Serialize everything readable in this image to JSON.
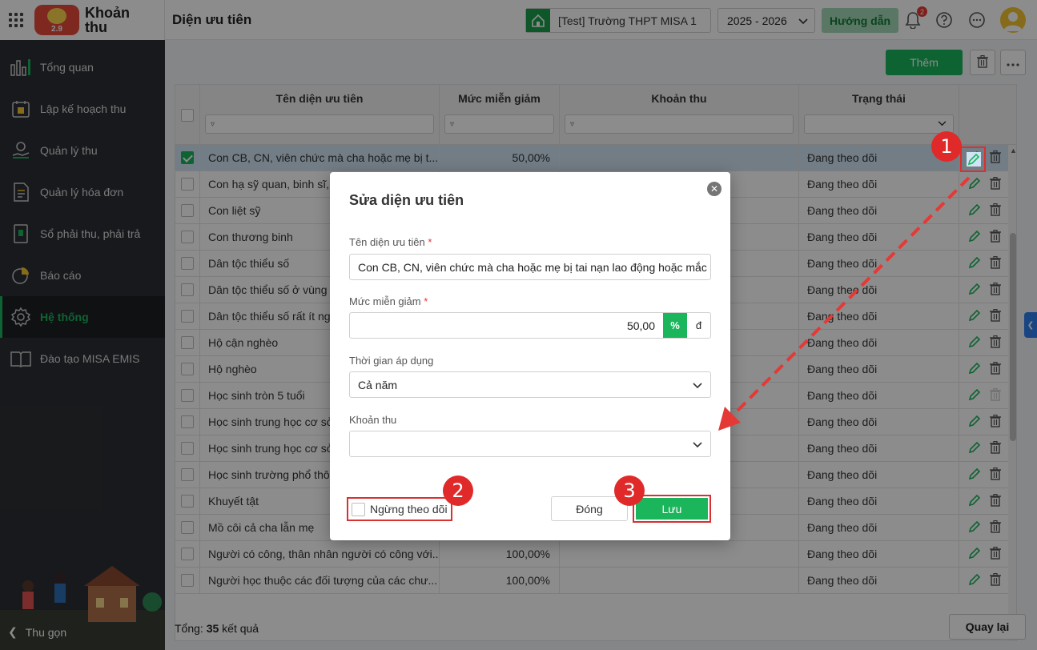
{
  "app": {
    "name": "Khoản thu",
    "logo_text": "2.9"
  },
  "sidebar": {
    "items": [
      {
        "label": "Tổng quan",
        "icon": "dashboard-icon"
      },
      {
        "label": "Lập kế hoạch thu",
        "icon": "calendar-money-icon"
      },
      {
        "label": "Quản lý thu",
        "icon": "hand-money-icon"
      },
      {
        "label": "Quản lý hóa đơn",
        "icon": "invoice-icon"
      },
      {
        "label": "Sổ phải thu, phải trả",
        "icon": "ledger-icon"
      },
      {
        "label": "Báo cáo",
        "icon": "pie-chart-icon"
      },
      {
        "label": "Hệ thống",
        "icon": "gear-icon",
        "active": true
      },
      {
        "label": "Đào tạo MISA EMIS",
        "icon": "book-icon"
      }
    ],
    "collapse_label": "Thu gọn"
  },
  "header": {
    "page_title": "Diện ưu tiên",
    "school": "[Test] Trường THPT MISA 1",
    "year": "2025 - 2026",
    "guide_label": "Hướng dẫn",
    "notification_count": "2"
  },
  "toolbar": {
    "add_label": "Thêm"
  },
  "table": {
    "columns": [
      "Tên diện ưu tiên",
      "Mức miễn giảm",
      "Khoản thu",
      "Trạng thái"
    ],
    "rows": [
      {
        "name": "Con CB, CN, viên chức mà cha hoặc mẹ bị t...",
        "rate": "50,00%",
        "fee": "",
        "status": "Đang theo dõi",
        "selected": true
      },
      {
        "name": "Con hạ sỹ quan, binh sĩ, c",
        "rate": "",
        "fee": "",
        "status": "Đang theo dõi"
      },
      {
        "name": "Con liệt sỹ",
        "rate": "",
        "fee": "",
        "status": "Đang theo dõi"
      },
      {
        "name": "Con thương binh",
        "rate": "",
        "fee": "",
        "status": "Đang theo dõi"
      },
      {
        "name": "Dân tộc thiểu số",
        "rate": "",
        "fee": "",
        "status": "Đang theo dõi"
      },
      {
        "name": "Dân tộc thiểu số ở vùng c",
        "rate": "",
        "fee": "",
        "status": "Đang theo dõi"
      },
      {
        "name": "Dân tộc thiểu số rất ít ngư",
        "rate": "",
        "fee": "",
        "status": "Đang theo dõi"
      },
      {
        "name": "Hộ cận nghèo",
        "rate": "",
        "fee": "",
        "status": "Đang theo dõi"
      },
      {
        "name": "Hộ nghèo",
        "rate": "",
        "fee": "",
        "status": "Đang theo dõi"
      },
      {
        "name": "Học sinh tròn 5 tuổi",
        "rate": "",
        "fee": "",
        "status": "Đang theo dõi"
      },
      {
        "name": "Học sinh trung học cơ sở",
        "rate": "",
        "fee": "",
        "status": "Đang theo dõi"
      },
      {
        "name": "Học sinh trung học cơ sở",
        "rate": "",
        "fee": "",
        "status": "Đang theo dõi"
      },
      {
        "name": "Học sinh trường phổ thôn",
        "rate": "",
        "fee": "",
        "status": "Đang theo dõi"
      },
      {
        "name": "Khuyết tật",
        "rate": "",
        "fee": "",
        "status": "Đang theo dõi"
      },
      {
        "name": "Mồ côi cả cha lẫn mẹ",
        "rate": "",
        "fee": "",
        "status": "Đang theo dõi"
      },
      {
        "name": "Người có công, thân nhân người có công với...",
        "rate": "100,00%",
        "fee": "",
        "status": "Đang theo dõi"
      },
      {
        "name": "Người học thuộc các đối tượng của các chư...",
        "rate": "100,00%",
        "fee": "",
        "status": "Đang theo dõi"
      }
    ]
  },
  "footer": {
    "total_label": "Tổng:",
    "total_count": "35",
    "total_suffix": "kết quả",
    "reload_label": "Quay lại"
  },
  "dialog": {
    "title": "Sửa diện ưu tiên",
    "name_label": "Tên diện ưu tiên",
    "name_value": "Con CB, CN, viên chức mà cha hoặc mẹ bị tai nạn lao động hoặc mắc b",
    "rate_label": "Mức miễn giảm",
    "rate_value": "50,00",
    "rate_unit_percent": "%",
    "rate_unit_currency": "đ",
    "period_label": "Thời gian áp dụng",
    "period_value": "Cả năm",
    "fee_label": "Khoản thu",
    "fee_value": "",
    "stop_label": "Ngừng theo dõi",
    "close_label": "Đóng",
    "save_label": "Lưu",
    "required_mark": "*"
  },
  "annotations": {
    "step1": "1",
    "step2": "2",
    "step3": "3"
  },
  "colors": {
    "accent": "#1bb55c",
    "highlight": "#d93030",
    "sidebar_bg": "#2c2f33"
  }
}
